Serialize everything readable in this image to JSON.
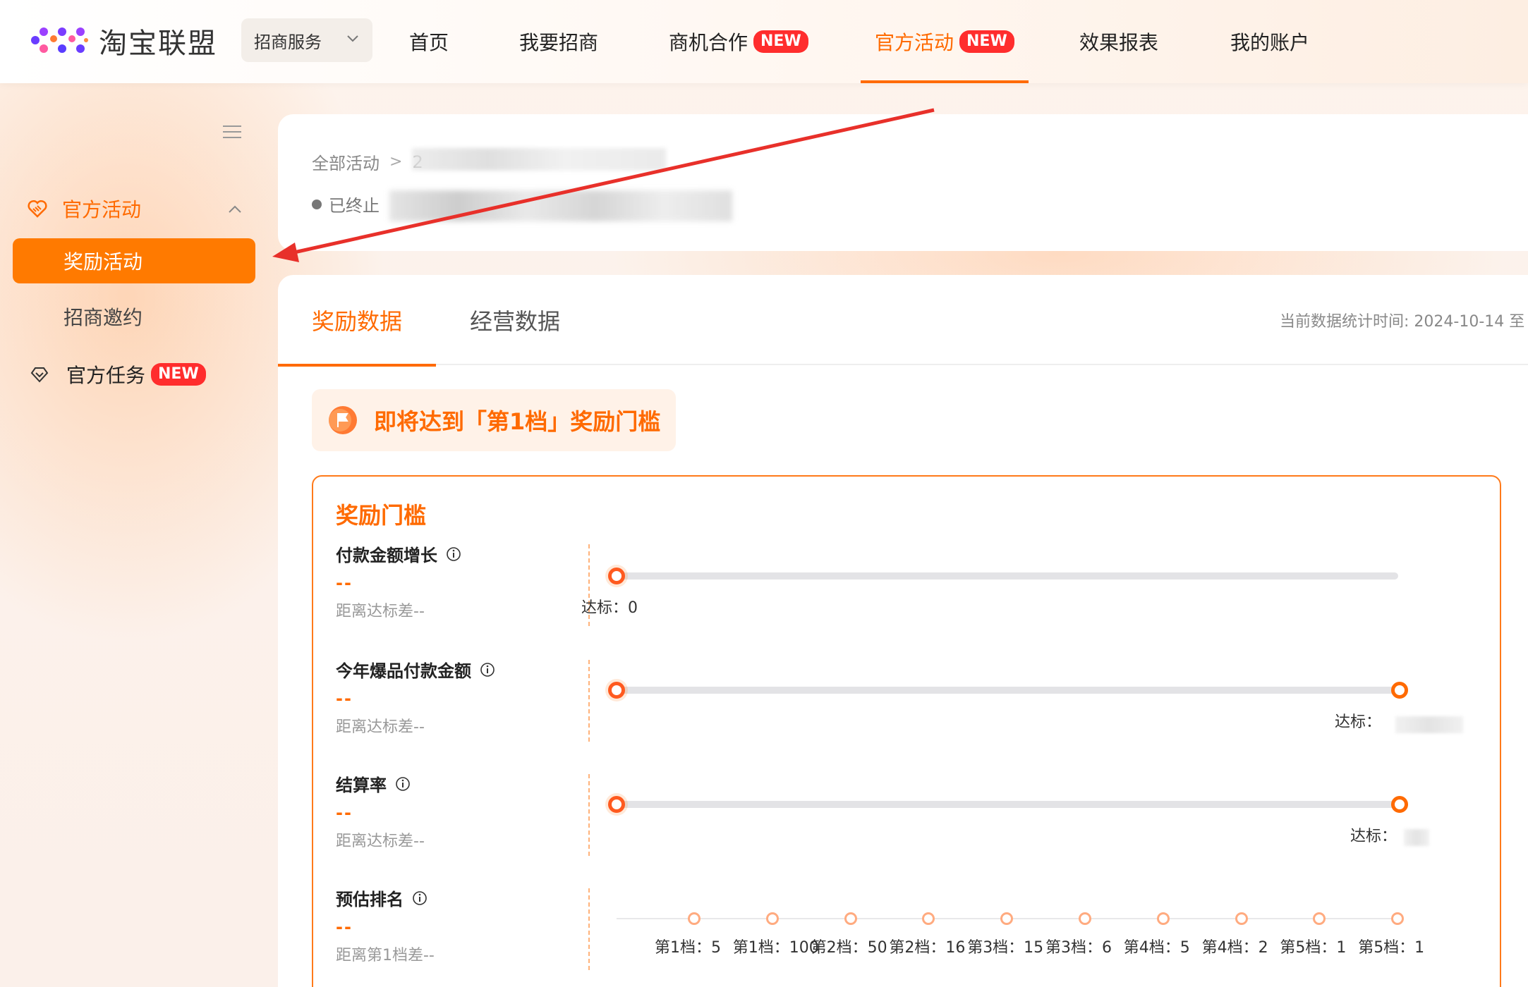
{
  "header": {
    "logo_text": "淘宝联盟",
    "service_dropdown": "招商服务",
    "nav": [
      {
        "label": "首页",
        "badge": ""
      },
      {
        "label": "我要招商",
        "badge": ""
      },
      {
        "label": "商机合作",
        "badge": "NEW"
      },
      {
        "label": "官方活动",
        "badge": "NEW"
      },
      {
        "label": "效果报表",
        "badge": ""
      },
      {
        "label": "我的账户",
        "badge": ""
      }
    ]
  },
  "sidebar": {
    "group_label": "官方活动",
    "active_item": "奖励活动",
    "item_invite": "招商邀约",
    "task_label": "官方任务",
    "task_badge": "NEW"
  },
  "activity": {
    "breadcrumb_root": "全部活动",
    "breadcrumb_current": "2",
    "status": "已终止"
  },
  "tabs": {
    "reward_data": "奖励数据",
    "business_data": "经营数据",
    "stat_time": "当前数据统计时间: 2024-10-14 至"
  },
  "notice": {
    "text": "即将达到「第1档」奖励门槛"
  },
  "threshold": {
    "title": "奖励门槛",
    "metrics": [
      {
        "name": "付款金额增长",
        "value": "--",
        "gap": "距离达标差--",
        "target_label": "达标：0"
      },
      {
        "name": "今年爆品付款金额",
        "value": "--",
        "gap": "距离达标差--",
        "target_label": "达标："
      },
      {
        "name": "结算率",
        "value": "--",
        "gap": "距离达标差--",
        "target_label": "达标："
      },
      {
        "name": "预估排名",
        "value": "--",
        "gap": "距离第1档差--"
      }
    ],
    "ranks": [
      "第1档：5",
      "第1档：100",
      "第2档：50",
      "第2档：16",
      "第3档：15",
      "第3档：6",
      "第4档：5",
      "第4档：2",
      "第5档：1",
      "第5档：1"
    ]
  },
  "colors": {
    "accent": "#ff6a00",
    "badge": "#ff2d2d",
    "annotation_arrow": "#e8302a"
  }
}
